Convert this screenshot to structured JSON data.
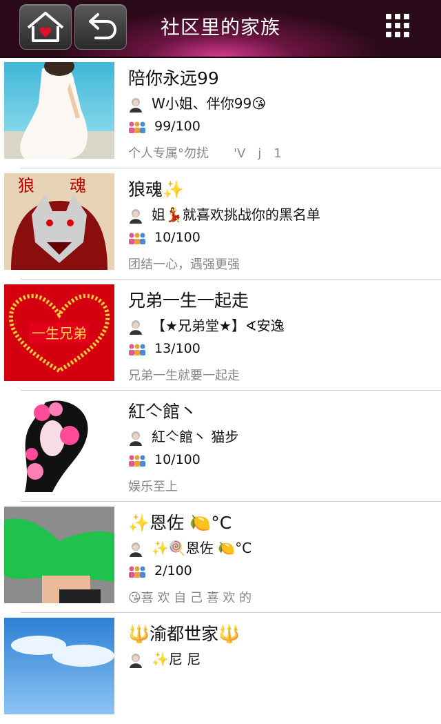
{
  "header": {
    "title": "社区里的家族"
  },
  "groups": [
    {
      "name": "陪你永远99",
      "owner": "W小姐、伴你99😘",
      "members": "99/100",
      "motto": "个人专属°勿扰　　'V　j　1"
    },
    {
      "name": "狼魂✨",
      "owner": "姐💃就喜欢挑战你的黑名单",
      "members": "10/100",
      "motto": "团结一心，遇强更强"
    },
    {
      "name": "兄弟一生一起走",
      "owner": "【★兄弟堂★】∢安逸",
      "members": "13/100",
      "motto": "兄弟一生就要一起走"
    },
    {
      "name": "紅亽館丶",
      "owner": "紅亽館丶 猫步",
      "members": "10/100",
      "motto": "娱乐至上"
    },
    {
      "name": "✨恩佐 🍋°C",
      "owner": "✨🍭恩佐 🍋°C",
      "members": "2/100",
      "motto": "😘喜 欢 自 己 喜 欢 的"
    },
    {
      "name": "🔱渝都世家🔱",
      "owner": "✨尼 尼",
      "members": "",
      "motto": ""
    }
  ]
}
